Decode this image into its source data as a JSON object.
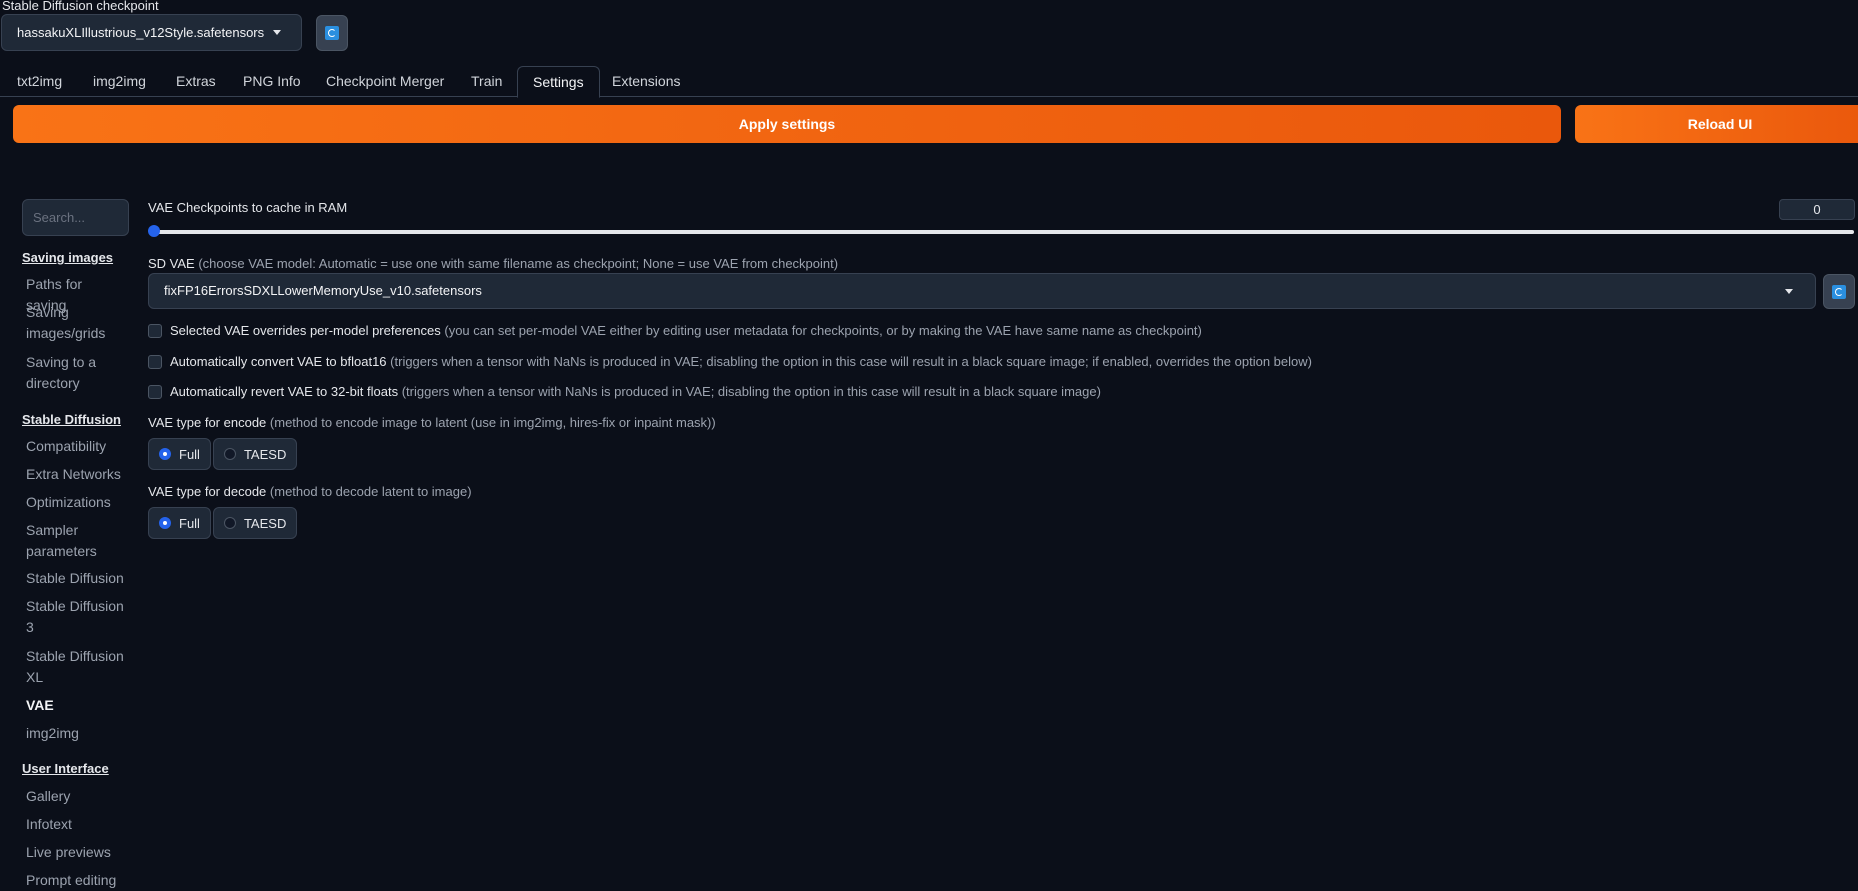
{
  "checkpoint": {
    "label": "Stable Diffusion checkpoint",
    "value": "hassakuXLIllustrious_v12Style.safetensors [bcc2"
  },
  "tabs": [
    "txt2img",
    "img2img",
    "Extras",
    "PNG Info",
    "Checkpoint Merger",
    "Train",
    "Settings",
    "Extensions"
  ],
  "active_tab": "Settings",
  "buttons": {
    "apply": "Apply settings",
    "reload": "Reload UI"
  },
  "sidebar": {
    "search_placeholder": "Search...",
    "saving_images": {
      "heading": "Saving images",
      "items": [
        "Paths for saving",
        "Saving images/grids",
        "Saving to a directory"
      ]
    },
    "stable_diffusion": {
      "heading": "Stable Diffusion",
      "items": [
        "Compatibility",
        "Extra Networks",
        "Optimizations",
        "Sampler parameters",
        "Stable Diffusion",
        "Stable Diffusion 3",
        "Stable Diffusion XL",
        "VAE",
        "img2img"
      ]
    },
    "user_interface": {
      "heading": "User Interface",
      "items": [
        "Gallery",
        "Infotext",
        "Live previews",
        "Prompt editing"
      ]
    },
    "active_item": "VAE"
  },
  "settings": {
    "vae_cache": {
      "label": "VAE Checkpoints to cache in RAM",
      "value": "0",
      "slider_fraction": 0
    },
    "sd_vae": {
      "label": "SD VAE",
      "hint": "(choose VAE model: Automatic = use one with same filename as checkpoint; None = use VAE from checkpoint)",
      "value": "fixFP16ErrorsSDXLLowerMemoryUse_v10.safetensors"
    },
    "override": {
      "label": "Selected VAE overrides per-model preferences",
      "hint": "(you can set per-model VAE either by editing user metadata for checkpoints, or by making the VAE have same name as checkpoint)",
      "checked": false
    },
    "bfloat16": {
      "label": "Automatically convert VAE to bfloat16",
      "hint": "(triggers when a tensor with NaNs is produced in VAE; disabling the option in this case will result in a black square image; if enabled, overrides the option below)",
      "checked": false
    },
    "revert32": {
      "label": "Automatically revert VAE to 32-bit floats",
      "hint": "(triggers when a tensor with NaNs is produced in VAE; disabling the option in this case will result in a black square image)",
      "checked": false
    },
    "encode": {
      "label": "VAE type for encode",
      "hint": "(method to encode image to latent (use in img2img, hires-fix or inpaint mask))",
      "options": [
        "Full",
        "TAESD"
      ],
      "selected": "Full"
    },
    "decode": {
      "label": "VAE type for decode",
      "hint": "(method to decode latent to image)",
      "options": [
        "Full",
        "TAESD"
      ],
      "selected": "Full"
    }
  },
  "colors": {
    "accent": "#f97316",
    "background": "#0b0f19",
    "selection": "#2563eb"
  }
}
